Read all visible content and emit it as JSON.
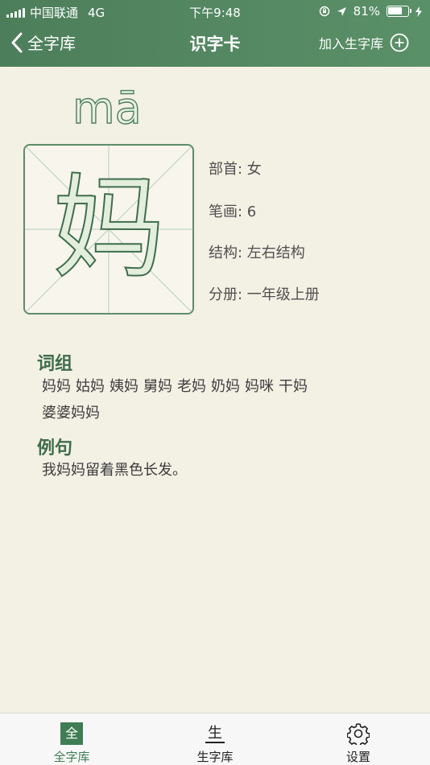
{
  "status": {
    "carrier": "中国联通",
    "network": "4G",
    "time": "下午9:48",
    "battery": "81%",
    "battery_level": 0.81
  },
  "nav": {
    "back_label": "全字库",
    "title": "识字卡",
    "add_label": "加入生字库"
  },
  "card": {
    "pinyin": "mā",
    "character": "妈",
    "radical": "部首: 女",
    "strokes": "笔画: 6",
    "structure": "结构: 左右结构",
    "volume": "分册: 一年级上册"
  },
  "words_section": {
    "title": "词组",
    "items": [
      "妈妈",
      "姑妈",
      "姨妈",
      "舅妈",
      "老妈",
      "奶妈",
      "妈咪",
      "干妈",
      "婆婆妈妈"
    ]
  },
  "sentence_section": {
    "title": "例句",
    "text": "我妈妈留着黑色长发。"
  },
  "tabbar": {
    "tabs": [
      {
        "label": "全字库",
        "glyph": "全",
        "color": "#3f7d54"
      },
      {
        "label": "生字库",
        "glyph": "生",
        "color": "#222222"
      },
      {
        "label": "设置",
        "glyph": "",
        "color": "#222222"
      }
    ]
  },
  "colors": {
    "header": "#4d7e5b",
    "accent": "#3f6d4c",
    "background": "#f3f0e4"
  }
}
